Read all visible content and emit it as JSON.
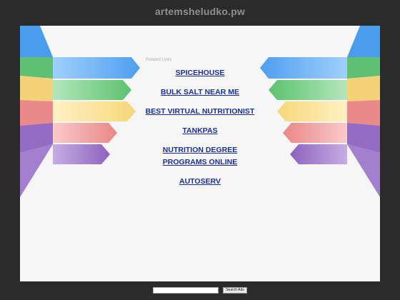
{
  "header": {
    "domain": "artemsheludko.pw"
  },
  "related": {
    "label": "Related Links"
  },
  "links": [
    {
      "label": "SPICEHOUSE"
    },
    {
      "label": "BULK SALT NEAR ME"
    },
    {
      "label": "BEST VIRTUAL NUTRITIONIST"
    },
    {
      "label": "TANKPAS"
    },
    {
      "label": "NUTRITION DEGREE PROGRAMS ONLINE"
    },
    {
      "label": "AUTOSERV"
    }
  ],
  "search": {
    "value": "",
    "button_label": "Search Ads"
  },
  "colors": {
    "background": "#2b2b2b",
    "panel": "#f6f6f6",
    "link": "#1a2f9a",
    "ribbon_blue": "#5aa8f0",
    "ribbon_green": "#6dc97e",
    "ribbon_yellow": "#f7dc8a",
    "ribbon_red": "#ec9494",
    "ribbon_purple": "#9a74c6"
  }
}
